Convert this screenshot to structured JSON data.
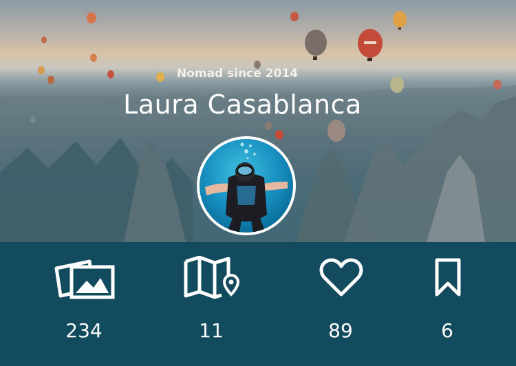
{
  "profile": {
    "subtitle": "Nomad since 2014",
    "name": "Laura Casablanca"
  },
  "stats": [
    {
      "icon": "photos-icon",
      "count": "234"
    },
    {
      "icon": "map-icon",
      "count": "11"
    },
    {
      "icon": "heart-icon",
      "count": "89"
    },
    {
      "icon": "bookmark-icon",
      "count": "6"
    }
  ],
  "colors": {
    "background": "#134b5e",
    "text": "#ffffff",
    "balloon_red": "#c44a3a",
    "balloon_orange": "#e08a46"
  }
}
